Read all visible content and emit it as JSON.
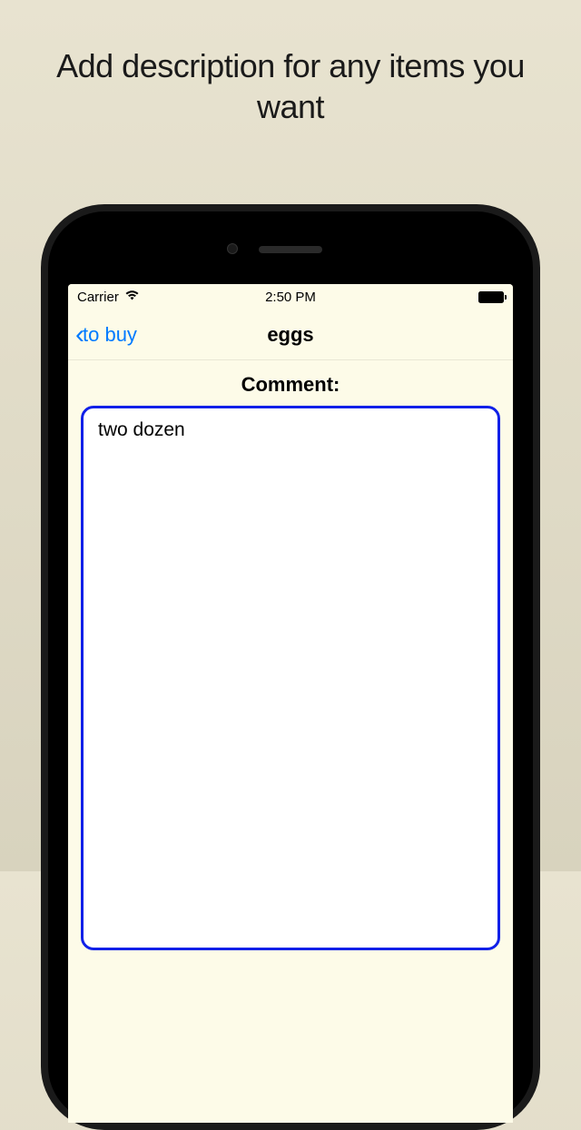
{
  "promo": {
    "heading": "Add description for any items you want"
  },
  "statusBar": {
    "carrier": "Carrier",
    "time": "2:50 PM"
  },
  "navBar": {
    "backLabel": "to buy",
    "title": "eggs"
  },
  "content": {
    "sectionHeader": "Comment:",
    "commentValue": "two dozen"
  }
}
